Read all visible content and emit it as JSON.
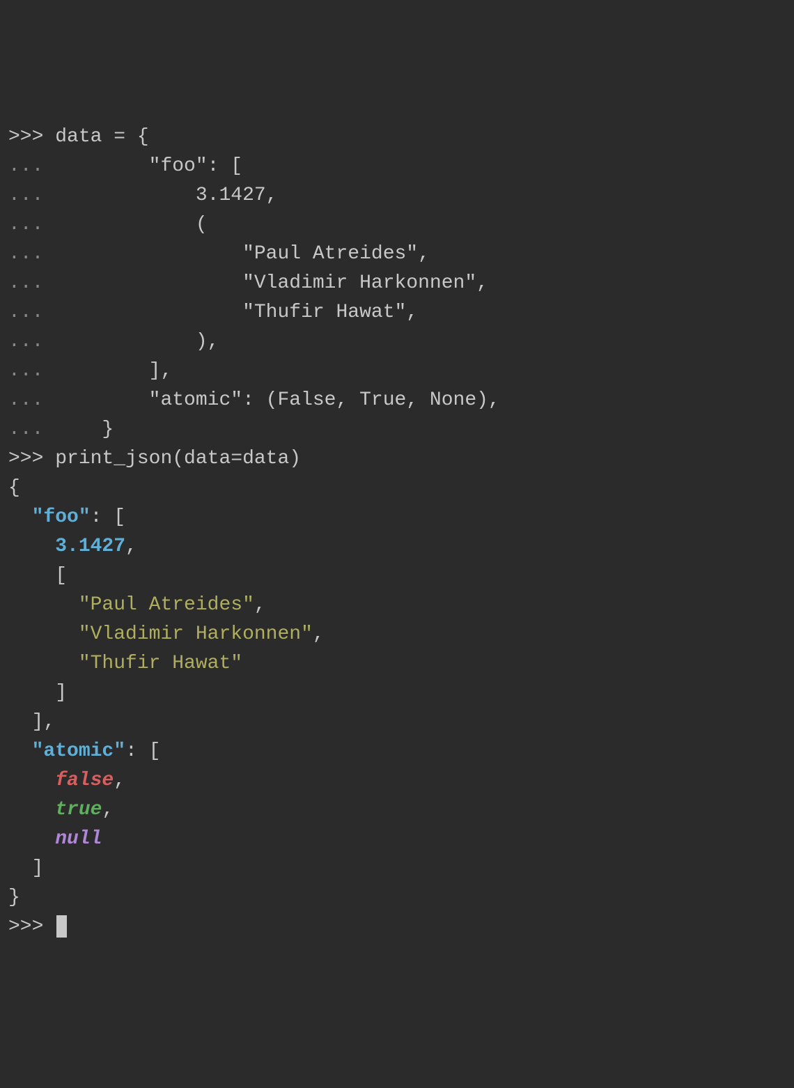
{
  "prompts": {
    "primary": ">>> ",
    "continuation": "... "
  },
  "input": {
    "l1": "data = {",
    "l2": "        \"foo\": [",
    "l3": "            3.1427,",
    "l4": "            (",
    "l5": "                \"Paul Atreides\",",
    "l6": "                \"Vladimir Harkonnen\",",
    "l7": "                \"Thufir Hawat\",",
    "l8": "            ),",
    "l9": "        ],",
    "l10": "        \"atomic\": (False, True, None),",
    "l11": "    }",
    "l12": "print_json(data=data)"
  },
  "output": {
    "brace_open": "{",
    "brace_close": "}",
    "bracket_open": "[",
    "bracket_close": "]",
    "colon_space": ": ",
    "comma": ",",
    "key_foo": "\"foo\"",
    "key_atomic": "\"atomic\"",
    "num": "3.1427",
    "str1": "\"Paul Atreides\"",
    "str2": "\"Vladimir Harkonnen\"",
    "str3": "\"Thufir Hawat\"",
    "false": "false",
    "true": "true",
    "null": "null",
    "ind1": "  ",
    "ind2": "    ",
    "ind3": "      "
  }
}
